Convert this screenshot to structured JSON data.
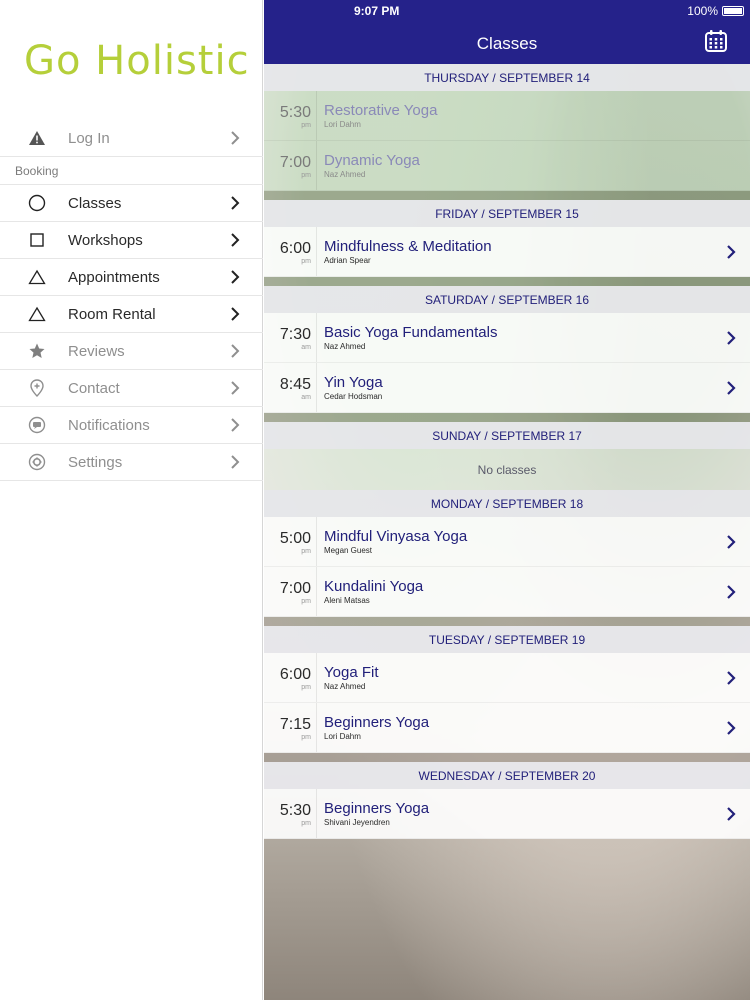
{
  "sidebar": {
    "logo": "Go Holistic",
    "login": "Log In",
    "section_booking": "Booking",
    "items": [
      {
        "label": "Classes",
        "icon": "circle-icon"
      },
      {
        "label": "Workshops",
        "icon": "square-icon"
      },
      {
        "label": "Appointments",
        "icon": "triangle-icon"
      },
      {
        "label": "Room Rental",
        "icon": "triangle-icon"
      },
      {
        "label": "Reviews",
        "icon": "star-icon"
      },
      {
        "label": "Contact",
        "icon": "location-pin-icon"
      },
      {
        "label": "Notifications",
        "icon": "chat-bubble-icon"
      },
      {
        "label": "Settings",
        "icon": "gear-icon"
      }
    ]
  },
  "status": {
    "time": "9:07 PM",
    "battery": "100%"
  },
  "header": {
    "title": "Classes"
  },
  "days": [
    {
      "label": "THURSDAY / SEPTEMBER 14",
      "classes": [
        {
          "time": "5:30",
          "ampm": "pm",
          "name": "Restorative Yoga",
          "instructor": "Lori Dahm"
        },
        {
          "time": "7:00",
          "ampm": "pm",
          "name": "Dynamic Yoga",
          "instructor": "Naz Ahmed"
        }
      ]
    },
    {
      "label": "FRIDAY / SEPTEMBER 15",
      "classes": [
        {
          "time": "6:00",
          "ampm": "pm",
          "name": "Mindfulness & Meditation",
          "instructor": "Adrian Spear"
        }
      ]
    },
    {
      "label": "SATURDAY / SEPTEMBER 16",
      "classes": [
        {
          "time": "7:30",
          "ampm": "am",
          "name": "Basic Yoga Fundamentals",
          "instructor": "Naz Ahmed"
        },
        {
          "time": "8:45",
          "ampm": "am",
          "name": "Yin Yoga",
          "instructor": "Cedar Hodsman"
        }
      ]
    },
    {
      "label": "SUNDAY / SEPTEMBER 17",
      "no_classes": "No classes"
    },
    {
      "label": "MONDAY / SEPTEMBER 18",
      "classes": [
        {
          "time": "5:00",
          "ampm": "pm",
          "name": "Mindful Vinyasa Yoga",
          "instructor": "Megan Guest"
        },
        {
          "time": "7:00",
          "ampm": "pm",
          "name": "Kundalini Yoga",
          "instructor": "Aleni Matsas"
        }
      ]
    },
    {
      "label": "TUESDAY / SEPTEMBER 19",
      "classes": [
        {
          "time": "6:00",
          "ampm": "pm",
          "name": "Yoga Fit",
          "instructor": "Naz Ahmed"
        },
        {
          "time": "7:15",
          "ampm": "pm",
          "name": "Beginners Yoga",
          "instructor": "Lori Dahm"
        }
      ]
    },
    {
      "label": "WEDNESDAY / SEPTEMBER 20",
      "classes": [
        {
          "time": "5:30",
          "ampm": "pm",
          "name": "Beginners Yoga",
          "instructor": "Shivani Jeyendren"
        }
      ]
    }
  ]
}
